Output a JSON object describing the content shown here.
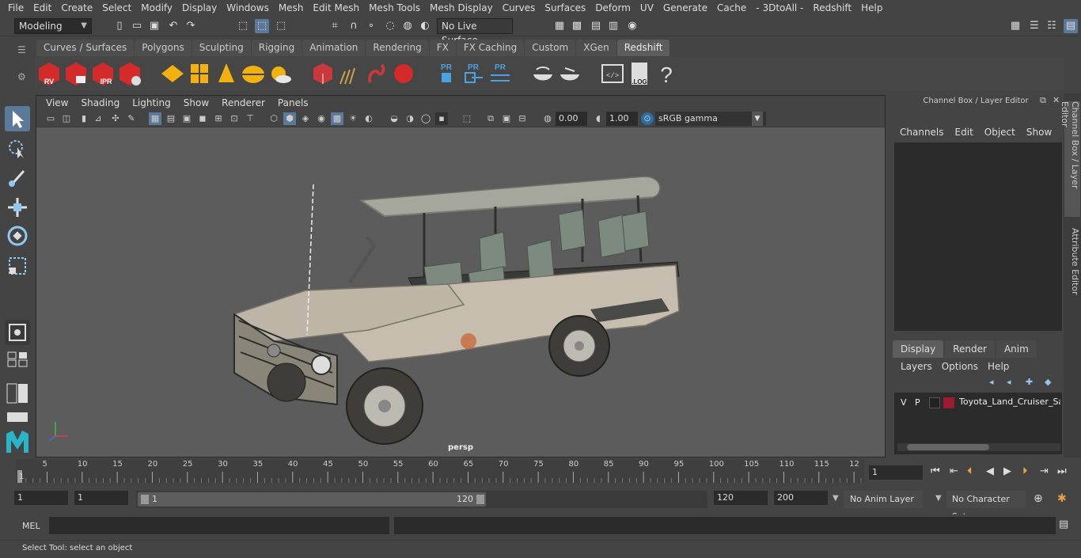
{
  "menu": [
    "File",
    "Edit",
    "Create",
    "Select",
    "Modify",
    "Display",
    "Windows",
    "Mesh",
    "Edit Mesh",
    "Mesh Tools",
    "Mesh Display",
    "Curves",
    "Surfaces",
    "Deform",
    "UV",
    "Generate",
    "Cache",
    "- 3DtoAll -",
    "Redshift",
    "Help"
  ],
  "status": {
    "mode": "Modeling",
    "live_surface": "No Live Surface"
  },
  "shelf_tabs": [
    "Curves / Surfaces",
    "Polygons",
    "Sculpting",
    "Rigging",
    "Animation",
    "Rendering",
    "FX",
    "FX Caching",
    "Custom",
    "XGen",
    "Redshift"
  ],
  "shelf_active": "Redshift",
  "shelf_icon_labels": {
    "rv": "RV",
    "ipr": "IPR",
    "pr": "PR",
    "log": ".LOG",
    "help": "?"
  },
  "viewport": {
    "menu": [
      "View",
      "Shading",
      "Lighting",
      "Show",
      "Renderer",
      "Panels"
    ],
    "exposure": "0.00",
    "gamma": "1.00",
    "colorspace": "sRGB gamma",
    "camera": "persp"
  },
  "channel_box": {
    "title": "Channel Box / Layer Editor",
    "menu": [
      "Channels",
      "Edit",
      "Object",
      "Show"
    ],
    "layer_tabs": [
      "Display",
      "Render",
      "Anim"
    ],
    "layer_menu": [
      "Layers",
      "Options",
      "Help"
    ],
    "layer": {
      "v": "V",
      "p": "P",
      "name": "Toyota_Land_Cruiser_Saf",
      "color": "#9b1c2e"
    }
  },
  "side_tabs": [
    "Channel Box / Layer Editor",
    "Attribute Editor"
  ],
  "timeline": {
    "ticks": [
      "5",
      "10",
      "15",
      "20",
      "25",
      "30",
      "35",
      "40",
      "45",
      "50",
      "55",
      "60",
      "65",
      "70",
      "75",
      "80",
      "85",
      "90",
      "95",
      "100",
      "105",
      "110",
      "115",
      "12"
    ],
    "start_label": "1",
    "current_frame": "1"
  },
  "range": {
    "start": "1",
    "inner_start": "1",
    "slider_start": "1",
    "slider_end": "120",
    "end": "120",
    "max": "200",
    "anim_layer": "No Anim Layer",
    "char_set": "No Character Set"
  },
  "cmd": {
    "label": "MEL"
  },
  "help_line": "Select Tool: select an object"
}
